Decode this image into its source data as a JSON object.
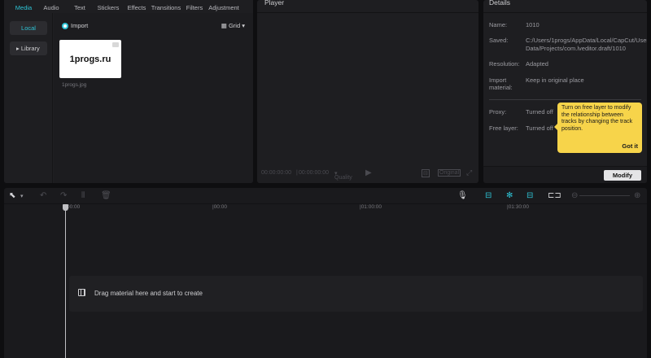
{
  "toolbar": {
    "tabs": [
      {
        "label": "Media",
        "icon": "media-icon"
      },
      {
        "label": "Audio",
        "icon": "audio-icon"
      },
      {
        "label": "Text",
        "icon": "text-icon"
      },
      {
        "label": "Stickers",
        "icon": "stickers-icon"
      },
      {
        "label": "Effects",
        "icon": "effects-icon"
      },
      {
        "label": "Transitions",
        "icon": "transitions-icon"
      },
      {
        "label": "Filters",
        "icon": "filters-icon"
      },
      {
        "label": "Adjustment",
        "icon": "adjustment-icon"
      }
    ],
    "active_tab": "Media"
  },
  "media": {
    "sidebar": {
      "local": "Local",
      "library": "Library"
    },
    "import_label": "Import",
    "view_label": "Grid",
    "thumbnail_text": "1progs.ru",
    "file_name": "1progs.jpg"
  },
  "player": {
    "title": "Player",
    "current_time": "00:00:00:00",
    "total_time": "00:00:00:00",
    "quality_label": "Quality",
    "ratio_label": "Original"
  },
  "details": {
    "title": "Details",
    "name_key": "Name:",
    "name_value": "1010",
    "saved_key": "Saved:",
    "saved_value": "C:/Users/1progs/AppData/Local/CapCut/User Data/Projects/com.lveditor.draft/1010",
    "resolution_key": "Resolution:",
    "resolution_value": "Adapted",
    "import_key": "Import material:",
    "import_value": "Keep in original place",
    "proxy_key": "Proxy:",
    "proxy_value": "Turned off",
    "freelayer_key": "Free layer:",
    "freelayer_value": "Turned off",
    "modify_label": "Modify"
  },
  "tooltip": {
    "text": "Turn on free layer to modify the relationship between tracks by changing the track position.",
    "action": "Got it"
  },
  "timeline": {
    "ticks": [
      "00:00",
      "|00:00",
      "|01:00:00",
      "|01:30:00"
    ],
    "drop_text": "Drag material here and start to create"
  },
  "colors": {
    "accent": "#2ec4d6",
    "tooltip_bg": "#f7d44a",
    "panel_bg": "#1e1e21"
  }
}
